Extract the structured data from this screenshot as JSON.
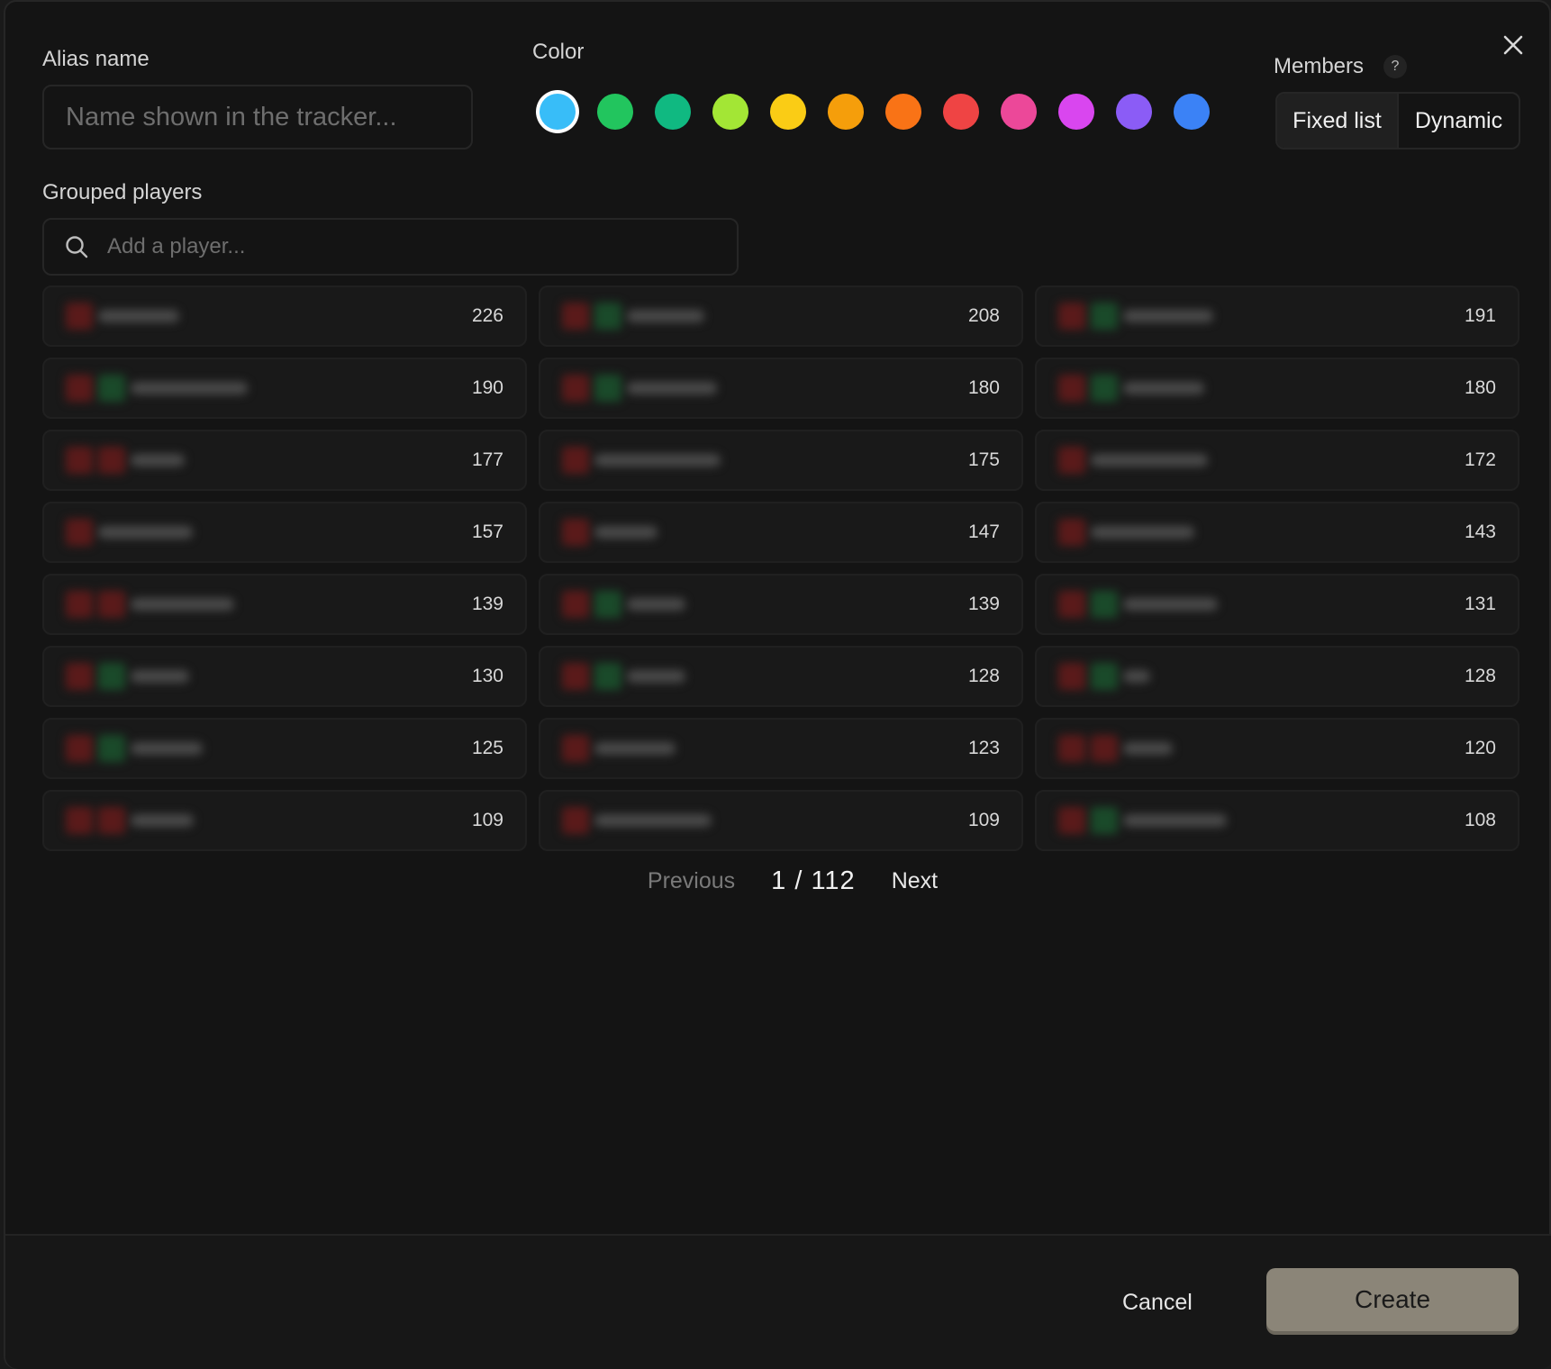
{
  "alias": {
    "label": "Alias name",
    "placeholder": "Name shown in the tracker..."
  },
  "color": {
    "label": "Color",
    "swatches": [
      "#38bdf8",
      "#22c55e",
      "#10b981",
      "#a3e635",
      "#facc15",
      "#f59e0b",
      "#f97316",
      "#ef4444",
      "#ec4899",
      "#d946ef",
      "#8b5cf6",
      "#3b82f6"
    ],
    "selected_index": 0
  },
  "members": {
    "label": "Members",
    "help": "?",
    "options": [
      "Fixed list",
      "Dynamic"
    ],
    "active": "Fixed list"
  },
  "grouped": {
    "label": "Grouped players",
    "search_placeholder": "Add a player..."
  },
  "players": [
    {
      "count": "226",
      "flags": [
        "#5a1a1a"
      ],
      "bar": 90
    },
    {
      "count": "208",
      "flags": [
        "#5a1a1a",
        "#1a4a2a"
      ],
      "bar": 86
    },
    {
      "count": "191",
      "flags": [
        "#5a1a1a",
        "#1a4a2a"
      ],
      "bar": 100
    },
    {
      "count": "190",
      "flags": [
        "#5a1a1a",
        "#1a4a2a"
      ],
      "bar": 130
    },
    {
      "count": "180",
      "flags": [
        "#5a1a1a",
        "#1a4a2a"
      ],
      "bar": 100
    },
    {
      "count": "180",
      "flags": [
        "#5a1a1a",
        "#1a4a2a"
      ],
      "bar": 90
    },
    {
      "count": "177",
      "flags": [
        "#5a1a1a",
        "#5a1a1a"
      ],
      "bar": 60
    },
    {
      "count": "175",
      "flags": [
        "#5a1a1a"
      ],
      "bar": 140
    },
    {
      "count": "172",
      "flags": [
        "#5a1a1a"
      ],
      "bar": 130
    },
    {
      "count": "157",
      "flags": [
        "#5a1a1a"
      ],
      "bar": 105
    },
    {
      "count": "147",
      "flags": [
        "#5a1a1a"
      ],
      "bar": 70
    },
    {
      "count": "143",
      "flags": [
        "#5a1a1a"
      ],
      "bar": 115
    },
    {
      "count": "139",
      "flags": [
        "#5a1a1a",
        "#5a1a1a"
      ],
      "bar": 115
    },
    {
      "count": "139",
      "flags": [
        "#5a1a1a",
        "#1a4a2a"
      ],
      "bar": 65
    },
    {
      "count": "131",
      "flags": [
        "#5a1a1a",
        "#1a4a2a"
      ],
      "bar": 105
    },
    {
      "count": "130",
      "flags": [
        "#5a1a1a",
        "#1a4a2a"
      ],
      "bar": 65
    },
    {
      "count": "128",
      "flags": [
        "#5a1a1a",
        "#1a4a2a"
      ],
      "bar": 65
    },
    {
      "count": "128",
      "flags": [
        "#5a1a1a",
        "#1a4a2a"
      ],
      "bar": 30
    },
    {
      "count": "125",
      "flags": [
        "#5a1a1a",
        "#1a4a2a"
      ],
      "bar": 80
    },
    {
      "count": "123",
      "flags": [
        "#5a1a1a"
      ],
      "bar": 90
    },
    {
      "count": "120",
      "flags": [
        "#5a1a1a",
        "#5a1a1a"
      ],
      "bar": 55
    },
    {
      "count": "109",
      "flags": [
        "#5a1a1a",
        "#5a1a1a"
      ],
      "bar": 70
    },
    {
      "count": "109",
      "flags": [
        "#5a1a1a"
      ],
      "bar": 130
    },
    {
      "count": "108",
      "flags": [
        "#5a1a1a",
        "#1a4a2a"
      ],
      "bar": 115
    }
  ],
  "pagination": {
    "previous": "Previous",
    "info": "1 / 112",
    "next": "Next"
  },
  "footer": {
    "cancel": "Cancel",
    "create": "Create"
  }
}
